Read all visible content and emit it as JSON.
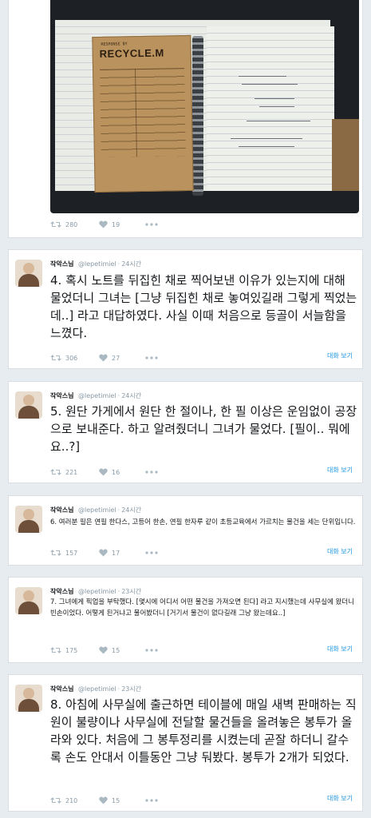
{
  "photo_tweet": {
    "image": {
      "tag_small": "RESPONSE BY",
      "tag_brand": "RECYCLE.M",
      "signature": "그뤂이"
    },
    "retweets": "280",
    "likes": "19"
  },
  "tweets": [
    {
      "author": "작악스님",
      "handle": "@lepetimiel",
      "time": "24시간",
      "text": "4. 혹시 노트를 뒤집힌 채로 찍어보낸 이유가 있는지에 대해 물었더니 그녀는 [그냥 뒤집힌 채로 놓여있길래 그렇게 찍었는데..] 라고 대답하였다. 사실 이때 처음으로 등골이 서늘함을 느꼈다.",
      "retweets": "306",
      "likes": "27",
      "view_conversation": "대화 보기"
    },
    {
      "author": "작악스님",
      "handle": "@lepetimiel",
      "time": "24시간",
      "text": "5. 원단 가게에서 원단 한 절이나, 한 필 이상은 운임없이 공장으로 보내준다. 하고 알려줬더니 그녀가 물었다. [필이.. 뭐에요..?]",
      "retweets": "221",
      "likes": "16",
      "view_conversation": "대화 보기"
    },
    {
      "author": "작악스님",
      "handle": "@lepetimiel",
      "time": "24시간",
      "text": "6. 여러분 필은 연필 한다스, 고등어 한손, 연필 한자루 같이 초등교육에서 가르치는 물건을 세는 단위입니다.",
      "retweets": "157",
      "likes": "17",
      "view_conversation": "대화 보기"
    },
    {
      "author": "작악스님",
      "handle": "@lepetimiel",
      "time": "23시간",
      "text": "7. 그녀에게 픽업을 부탁했다. [몇시에 어디서 어떤 물건을 가져오면 된다] 라고 지시했는데 사무실에 왔더니 빈손이었다. 어떻게 된거냐고 물어봤더니 [거기서 물건이 없다길래 그냥 왔는데요..]",
      "retweets": "175",
      "likes": "15",
      "view_conversation": "대화 보기"
    },
    {
      "author": "작악스님",
      "handle": "@lepetimiel",
      "time": "23시간",
      "text": "8. 아침에 사무실에 출근하면 테이블에 매일 새벽 판매하는 직원이 불량이나 사무실에 전달할 물건들을 올려놓은 봉투가 올라와 있다. 처음에 그 봉투정리를 시켰는데 곧잘 하더니 갈수록 손도 안대서 이틀동안 그냥 둬봤다. 봉투가 2개가 되었다.",
      "retweets": "210",
      "likes": "15",
      "view_conversation": "대화 보기"
    }
  ],
  "icons": {
    "retweet": "retweet-icon",
    "like": "heart-icon",
    "more": "more-dots-icon"
  }
}
